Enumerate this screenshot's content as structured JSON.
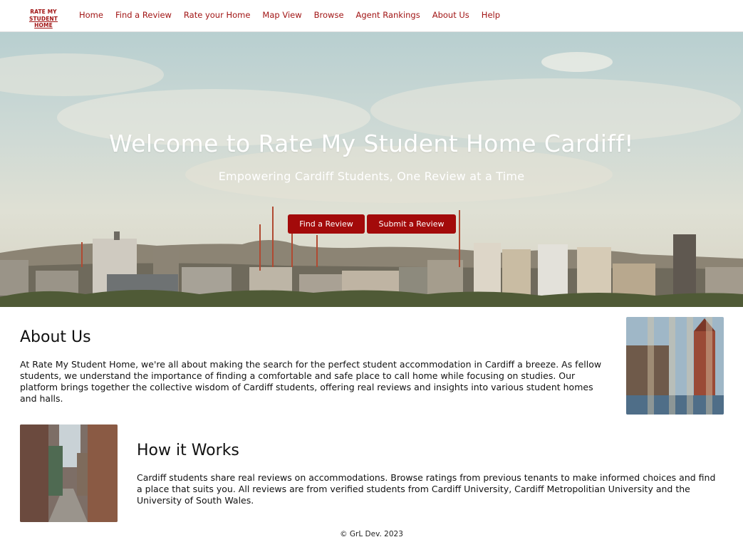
{
  "logo": {
    "line1": "RATE MY",
    "line2": "STUDENT HOME"
  },
  "nav": {
    "items": [
      "Home",
      "Find a Review",
      "Rate your Home",
      "Map View",
      "Browse",
      "Agent Rankings",
      "About Us",
      "Help"
    ]
  },
  "hero": {
    "title": "Welcome to Rate My Student Home Cardiff!",
    "subtitle": "Empowering Cardiff Students, One Review at a Time",
    "find_label": "Find a Review",
    "submit_label": "Submit a Review"
  },
  "about": {
    "title": "About Us",
    "text": "At Rate My Student Home, we're all about making the search for the perfect student accommodation in Cardiff a breeze. As fellow students, we understand the importance of finding a comfortable and safe place to call home while focusing on studies. Our platform brings together the collective wisdom of Cardiff students, offering real reviews and insights into various student homes and halls."
  },
  "how": {
    "title": "How it Works",
    "text": "Cardiff students share real reviews on accommodations. Browse ratings from previous tenants to make informed choices and find a place that suits you. All reviews are from verified students from Cardiff University, Cardiff Metropolitian University and the University of South Wales."
  },
  "footer": {
    "text": "© GrL Dev. 2023"
  },
  "colors": {
    "accent": "#a11515",
    "button": "#a30a0a"
  }
}
